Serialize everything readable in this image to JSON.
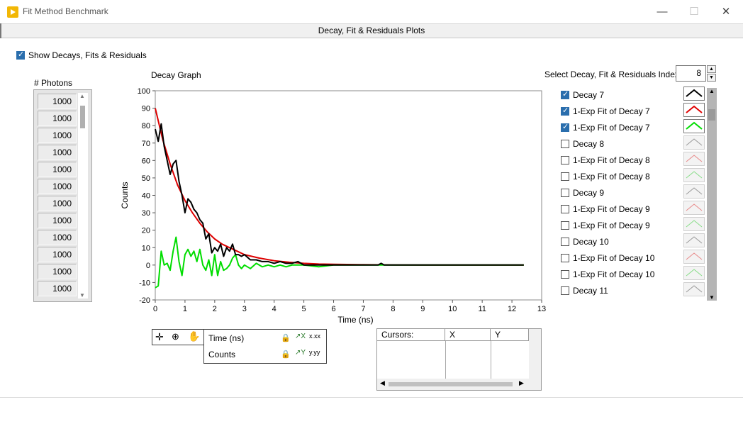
{
  "window": {
    "title": "Fit Method Benchmark",
    "minimize": "—",
    "maximize": "☐",
    "close": "✕"
  },
  "tab": {
    "label": "Decay, Fit & Residuals Plots"
  },
  "show_toggle": {
    "label": "Show Decays, Fits & Residuals",
    "checked": true
  },
  "photons": {
    "label": "# Photons",
    "values": [
      "1000",
      "1000",
      "1000",
      "1000",
      "1000",
      "1000",
      "1000",
      "1000",
      "1000",
      "1000",
      "1000",
      "1000"
    ]
  },
  "graph": {
    "title": "Decay Graph"
  },
  "index": {
    "label": "Select Decay, Fit & Residuals Index",
    "value": "8"
  },
  "legend": [
    {
      "name": "Decay 7",
      "checked": true,
      "color": "#000000"
    },
    {
      "name": "1-Exp Fit of Decay 7",
      "checked": true,
      "color": "#e00000"
    },
    {
      "name": "1-Exp Fit of Decay 7",
      "checked": true,
      "color": "#00dd00"
    },
    {
      "name": "Decay 8",
      "checked": false,
      "color": "#999999"
    },
    {
      "name": "1-Exp Fit of Decay 8",
      "checked": false,
      "color": "#e88888"
    },
    {
      "name": "1-Exp Fit of Decay 8",
      "checked": false,
      "color": "#88dd88"
    },
    {
      "name": "Decay 9",
      "checked": false,
      "color": "#999999"
    },
    {
      "name": "1-Exp Fit of Decay 9",
      "checked": false,
      "color": "#e88888"
    },
    {
      "name": "1-Exp Fit of Decay 9",
      "checked": false,
      "color": "#88dd88"
    },
    {
      "name": "Decay 10",
      "checked": false,
      "color": "#999999"
    },
    {
      "name": "1-Exp Fit of Decay 10",
      "checked": false,
      "color": "#e88888"
    },
    {
      "name": "1-Exp Fit of Decay 10",
      "checked": false,
      "color": "#88dd88"
    },
    {
      "name": "Decay 11",
      "checked": false,
      "color": "#999999"
    }
  ],
  "scale_legend": {
    "x_name": "Time (ns)",
    "x_format": "x.xx",
    "y_name": "Counts",
    "y_format": "y.yy"
  },
  "cursors": {
    "headers": [
      "Cursors:",
      "X",
      "Y"
    ]
  },
  "chart_data": {
    "type": "line",
    "title": "",
    "xlabel": "Time (ns)",
    "ylabel": "Counts",
    "xlim": [
      0,
      13
    ],
    "ylim": [
      -20,
      100
    ],
    "xticks": [
      "0",
      "1",
      "2",
      "3",
      "4",
      "5",
      "6",
      "7",
      "8",
      "9",
      "10",
      "11",
      "12",
      "13"
    ],
    "yticks": [
      "100",
      "90",
      "80",
      "70",
      "60",
      "50",
      "40",
      "30",
      "20",
      "10",
      "0",
      "-10",
      "-20"
    ],
    "grid": false,
    "series": [
      {
        "name": "Decay 7",
        "color": "#000000",
        "x": [
          0,
          0.1,
          0.2,
          0.3,
          0.4,
          0.5,
          0.6,
          0.7,
          0.8,
          0.9,
          1.0,
          1.1,
          1.2,
          1.3,
          1.4,
          1.5,
          1.6,
          1.7,
          1.8,
          1.9,
          2.0,
          2.1,
          2.2,
          2.3,
          2.4,
          2.5,
          2.6,
          2.7,
          2.8,
          2.9,
          3.0,
          3.2,
          3.4,
          3.6,
          3.8,
          4.0,
          4.2,
          4.4,
          4.6,
          4.8,
          5.0,
          5.5,
          6.0,
          6.5,
          7.0,
          7.5,
          7.6,
          7.7,
          8.0,
          9.0,
          10.0,
          11.0,
          12.0,
          12.4
        ],
        "y": [
          78,
          71,
          81,
          68,
          60,
          52,
          58,
          60,
          48,
          40,
          30,
          38,
          36,
          32,
          30,
          26,
          24,
          15,
          18,
          7,
          10,
          8,
          12,
          5,
          10,
          8,
          12,
          6,
          6,
          5,
          6,
          3,
          3,
          2,
          2,
          1,
          2,
          1,
          1,
          2,
          0,
          0,
          0,
          0,
          0,
          0,
          1,
          0,
          0,
          0,
          0,
          0,
          0,
          0
        ]
      },
      {
        "name": "1-Exp Fit of Decay 7",
        "color": "#dd0000",
        "x": [
          0,
          0.25,
          0.5,
          0.75,
          1.0,
          1.25,
          1.5,
          1.75,
          2.0,
          2.25,
          2.5,
          2.75,
          3.0,
          3.5,
          4.0,
          4.5,
          5.0,
          5.5,
          6.0,
          7.0,
          8.0,
          9.0,
          10.0,
          11.0,
          12.0,
          12.4
        ],
        "y": [
          90,
          72,
          58,
          46,
          37,
          30,
          24,
          19,
          15,
          12,
          10,
          8,
          6,
          4,
          2.5,
          1.6,
          1,
          0.6,
          0.4,
          0.2,
          0.1,
          0,
          0,
          0,
          0,
          0
        ]
      },
      {
        "name": "1-Exp Fit of Decay 7",
        "color": "#00dd00",
        "x": [
          0,
          0.1,
          0.2,
          0.3,
          0.4,
          0.5,
          0.6,
          0.7,
          0.8,
          0.9,
          1.0,
          1.1,
          1.2,
          1.3,
          1.4,
          1.5,
          1.6,
          1.7,
          1.8,
          1.9,
          2.0,
          2.1,
          2.2,
          2.3,
          2.4,
          2.5,
          2.6,
          2.7,
          2.8,
          2.9,
          3.0,
          3.2,
          3.4,
          3.6,
          3.8,
          4.0,
          4.2,
          4.4,
          4.6,
          4.8,
          5.0,
          5.5,
          6.0,
          7.0,
          8.0,
          9.0,
          10.0,
          11.0,
          12.0,
          12.4
        ],
        "y": [
          -13,
          -12,
          8,
          0,
          1,
          -3,
          8,
          16,
          2,
          -6,
          6,
          9,
          5,
          8,
          2,
          9,
          0,
          -3,
          3,
          -6,
          6,
          -6,
          2,
          -3,
          -2,
          0,
          4,
          6,
          0,
          -2,
          0,
          -2,
          1,
          -1,
          0,
          -1,
          0,
          -1,
          0,
          0,
          0,
          -1,
          0,
          0,
          0,
          0,
          0,
          0,
          0,
          0
        ]
      }
    ]
  }
}
